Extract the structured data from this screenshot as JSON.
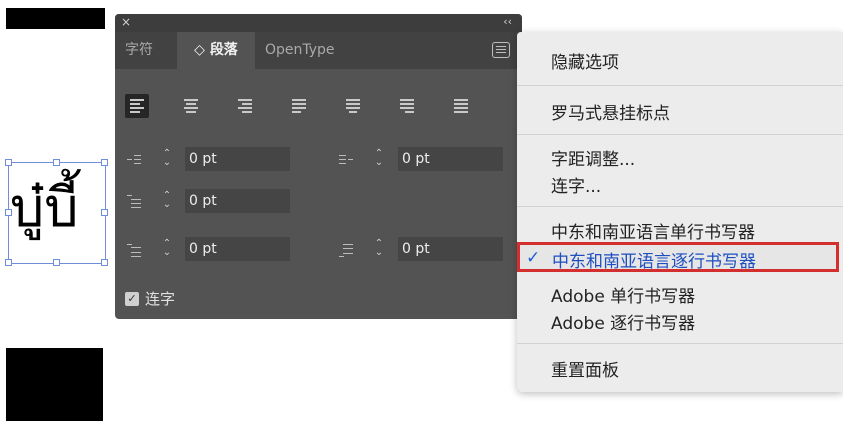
{
  "panel": {
    "close_glyph": "×",
    "collapse_glyph": "‹‹",
    "tabs": [
      {
        "label": "字符",
        "active": false
      },
      {
        "label": "◇ 段落",
        "active": true
      },
      {
        "label": "OpenType",
        "active": false
      }
    ],
    "alignment_selected": "align-left",
    "fields": {
      "left_indent": "0 pt",
      "right_indent": "0 pt",
      "first_line_indent": "0 pt",
      "space_before": "0 pt",
      "space_after": "0 pt"
    },
    "hyphenation": {
      "label": "连字",
      "checked": true
    }
  },
  "canvas": {
    "thai_text": "บู๋บี้"
  },
  "menu": {
    "items": {
      "hide_options": "隐藏选项",
      "roman_hanging": "罗马式悬挂标点",
      "kerning": "字距调整...",
      "hyphenation": "连字...",
      "me_single_line": "中东和南亚语言单行书写器",
      "me_every_line": "中东和南亚语言逐行书写器",
      "adobe_single": "Adobe 单行书写器",
      "adobe_every": "Adobe 逐行书写器",
      "reset_panel": "重置面板"
    },
    "checked_item": "me_every_line",
    "checkmark": "✓",
    "highlight_color": "#d32f2f"
  }
}
